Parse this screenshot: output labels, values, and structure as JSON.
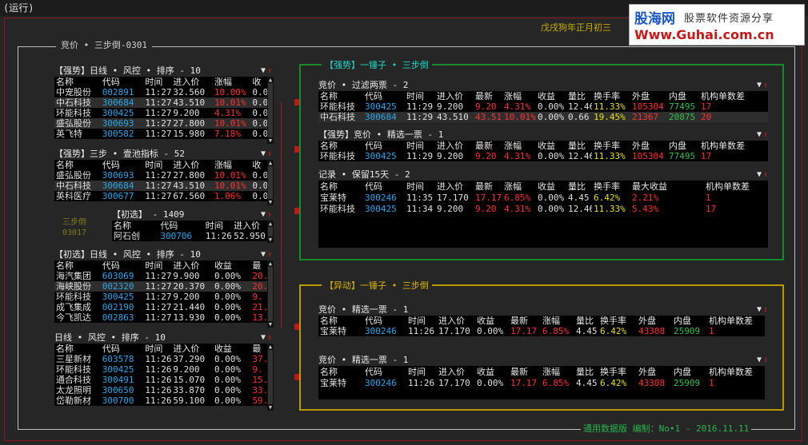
{
  "window": {
    "status": "(运行)"
  },
  "logo": {
    "name": "股海网",
    "slogan": "股票软件资源分享",
    "url": "Www.Guhai.com.cn"
  },
  "date_text": "戊戌狗年正月初三",
  "group_title": "竞价 • 三步倒-0301",
  "side_label": {
    "line1": "三步倒",
    "line2": "03017"
  },
  "footer_text": "通用数据版  编制：No•1 - 2016.11.11",
  "left_panels": {
    "p1": {
      "title": "【强势】日线 • 风控 • 排序 - 10",
      "headers": [
        "名称",
        "代码",
        "时间",
        "进入价",
        "涨幅",
        "收"
      ],
      "rows": [
        [
          "中宠股份",
          "002891",
          "11:27",
          "32.560",
          "10.00%",
          "0.0"
        ],
        [
          "中石科技",
          "300684",
          "11:27",
          "43.510",
          "10.01%",
          "0.0"
        ],
        [
          "环能科技",
          "300425",
          "11:27",
          "9.200",
          "4.31%",
          "0.0"
        ],
        [
          "盛弘股份",
          "300693",
          "11:27",
          "27.800",
          "10.01%",
          "0.0"
        ],
        [
          "英飞特",
          "300582",
          "11:27",
          "15.980",
          "7.18%",
          "0.0"
        ]
      ]
    },
    "p2": {
      "title": "【强势】三步 • 壹池指标 - 52",
      "headers": [
        "名称",
        "代码",
        "时间",
        "进入价",
        "涨幅",
        "收"
      ],
      "rows": [
        [
          "盛弘股份",
          "300693",
          "11:27",
          "27.800",
          "10.01%",
          "0.0"
        ],
        [
          "中石科技",
          "300684",
          "11:27",
          "43.510",
          "10.01%",
          "0.0"
        ],
        [
          "英科医疗",
          "300677",
          "11:27",
          "67.560",
          "1.06%",
          "0.0"
        ]
      ]
    },
    "p3": {
      "title": "【初选】 - 1409",
      "headers": [
        "名称",
        "代码",
        "时间",
        "进入价"
      ],
      "rows": [
        [
          "阿石创",
          "300706",
          "11:26",
          "52.950"
        ]
      ]
    },
    "p4": {
      "title": "【初选】日线 • 风控 • 排序 - 10",
      "headers": [
        "名称",
        "代码",
        "时间",
        "进入价",
        "收益",
        "最"
      ],
      "rows": [
        [
          "海汽集团",
          "603069",
          "11:27",
          "9.900",
          "0.00%",
          "20."
        ],
        [
          "海峡股份",
          "002320",
          "11:27",
          "20.370",
          "0.00%",
          "20."
        ],
        [
          "环能科技",
          "300425",
          "11:27",
          "9.200",
          "0.00%",
          "9."
        ],
        [
          "成飞集成",
          "002190",
          "11:27",
          "21.440",
          "0.00%",
          "21."
        ],
        [
          "今飞凯达",
          "002863",
          "11:27",
          "13.930",
          "0.00%",
          "13."
        ]
      ]
    },
    "p5": {
      "title": "日线 • 风控 • 排序 - 10",
      "headers": [
        "名称",
        "代码",
        "时间",
        "进入价",
        "收益",
        "最"
      ],
      "rows": [
        [
          "三星新材",
          "603578",
          "11:26",
          "37.290",
          "0.00%",
          "37."
        ],
        [
          "环能科技",
          "300425",
          "11:26",
          "9.200",
          "0.00%",
          "9."
        ],
        [
          "通合科技",
          "300491",
          "11:26",
          "15.070",
          "0.00%",
          "15."
        ],
        [
          "太龙照明",
          "300650",
          "11:26",
          "33.870",
          "0.00%",
          "33."
        ],
        [
          "岱勒新材",
          "300700",
          "11:26",
          "59.100",
          "0.00%",
          "59."
        ]
      ]
    }
  },
  "green_box": {
    "title": "【强势】一锤子 • 三步倒",
    "t1": {
      "title": "竞价 • 过滤两票 - 2",
      "headers": [
        "名称",
        "代码",
        "时间",
        "进入价",
        "最新",
        "涨幅",
        "收益",
        "量比",
        "换手率",
        "外盘",
        "内盘",
        "机构单数差"
      ],
      "rows": [
        [
          "环能科技",
          "300425",
          "11:29",
          "9.200",
          "9.20",
          "4.31%",
          "0.00%",
          "12.46",
          "11.33%",
          "105304",
          "77495",
          "17"
        ],
        [
          "中石科技",
          "300684",
          "11:29",
          "43.510",
          "43.51",
          "10.01%",
          "0.00%",
          "0.66",
          "19.45%",
          "21367",
          "20875",
          "20"
        ]
      ]
    },
    "t2": {
      "title": "【强势】竞价 • 精选一票 - 1",
      "headers": [
        "名称",
        "代码",
        "时间",
        "进入价",
        "最新",
        "涨幅",
        "收益",
        "量比",
        "换手率",
        "外盘",
        "内盘",
        "机构单数差"
      ],
      "rows": [
        [
          "环能科技",
          "300425",
          "11:29",
          "9.200",
          "9.20",
          "4.31%",
          "0.00%",
          "12.46",
          "11.33%",
          "105304",
          "77495",
          "17"
        ]
      ]
    },
    "t3": {
      "title": "记录 • 保留15天 - 2",
      "headers": [
        "名称",
        "代码",
        "时间",
        "进入价",
        "最新",
        "涨幅",
        "收益",
        "量比",
        "换手率",
        "最大收益",
        "机构单数差"
      ],
      "rows": [
        [
          "宝莱特",
          "300246",
          "11:35",
          "17.170",
          "17.17",
          "6.85%",
          "0.00%",
          "4.45",
          "6.42%",
          "2.21%",
          "1"
        ],
        [
          "环能科技",
          "300425",
          "11:34",
          "9.200",
          "9.20",
          "4.31%",
          "0.00%",
          "12.46",
          "11.33%",
          "5.43%",
          "17"
        ]
      ]
    }
  },
  "yellow_box": {
    "title": "【异动】一锤子 • 三步倒",
    "t1": {
      "title": "竞价 • 精选一票 - 1",
      "headers": [
        "名称",
        "代码",
        "时间",
        "进入价",
        "收益",
        "最新",
        "涨幅",
        "量比",
        "换手率",
        "外盘",
        "内盘",
        "机构单数差"
      ],
      "rows": [
        [
          "宝莱特",
          "300246",
          "11:26",
          "17.170",
          "0.00%",
          "17.17",
          "6.85%",
          "4.45",
          "6.42%",
          "43308",
          "25909",
          "1"
        ]
      ]
    },
    "t2": {
      "title": "竞价 • 精选一票 - 1",
      "headers": [
        "名称",
        "代码",
        "时间",
        "进入价",
        "收益",
        "最新",
        "涨幅",
        "量比",
        "换手率",
        "外盘",
        "内盘",
        "机构单数差"
      ],
      "rows": [
        [
          "宝莱特",
          "300246",
          "11:26",
          "17.170",
          "0.00%",
          "17.17",
          "6.85%",
          "4.45",
          "6.42%",
          "43308",
          "25909",
          "1"
        ]
      ]
    }
  },
  "colors": {
    "up": "#ff3030",
    "code": "#2aa7e8",
    "volume_in": "#32c050",
    "turnover": "#e8e000",
    "green_frame": "#178a2e",
    "yellow_frame": "#b89a00"
  }
}
